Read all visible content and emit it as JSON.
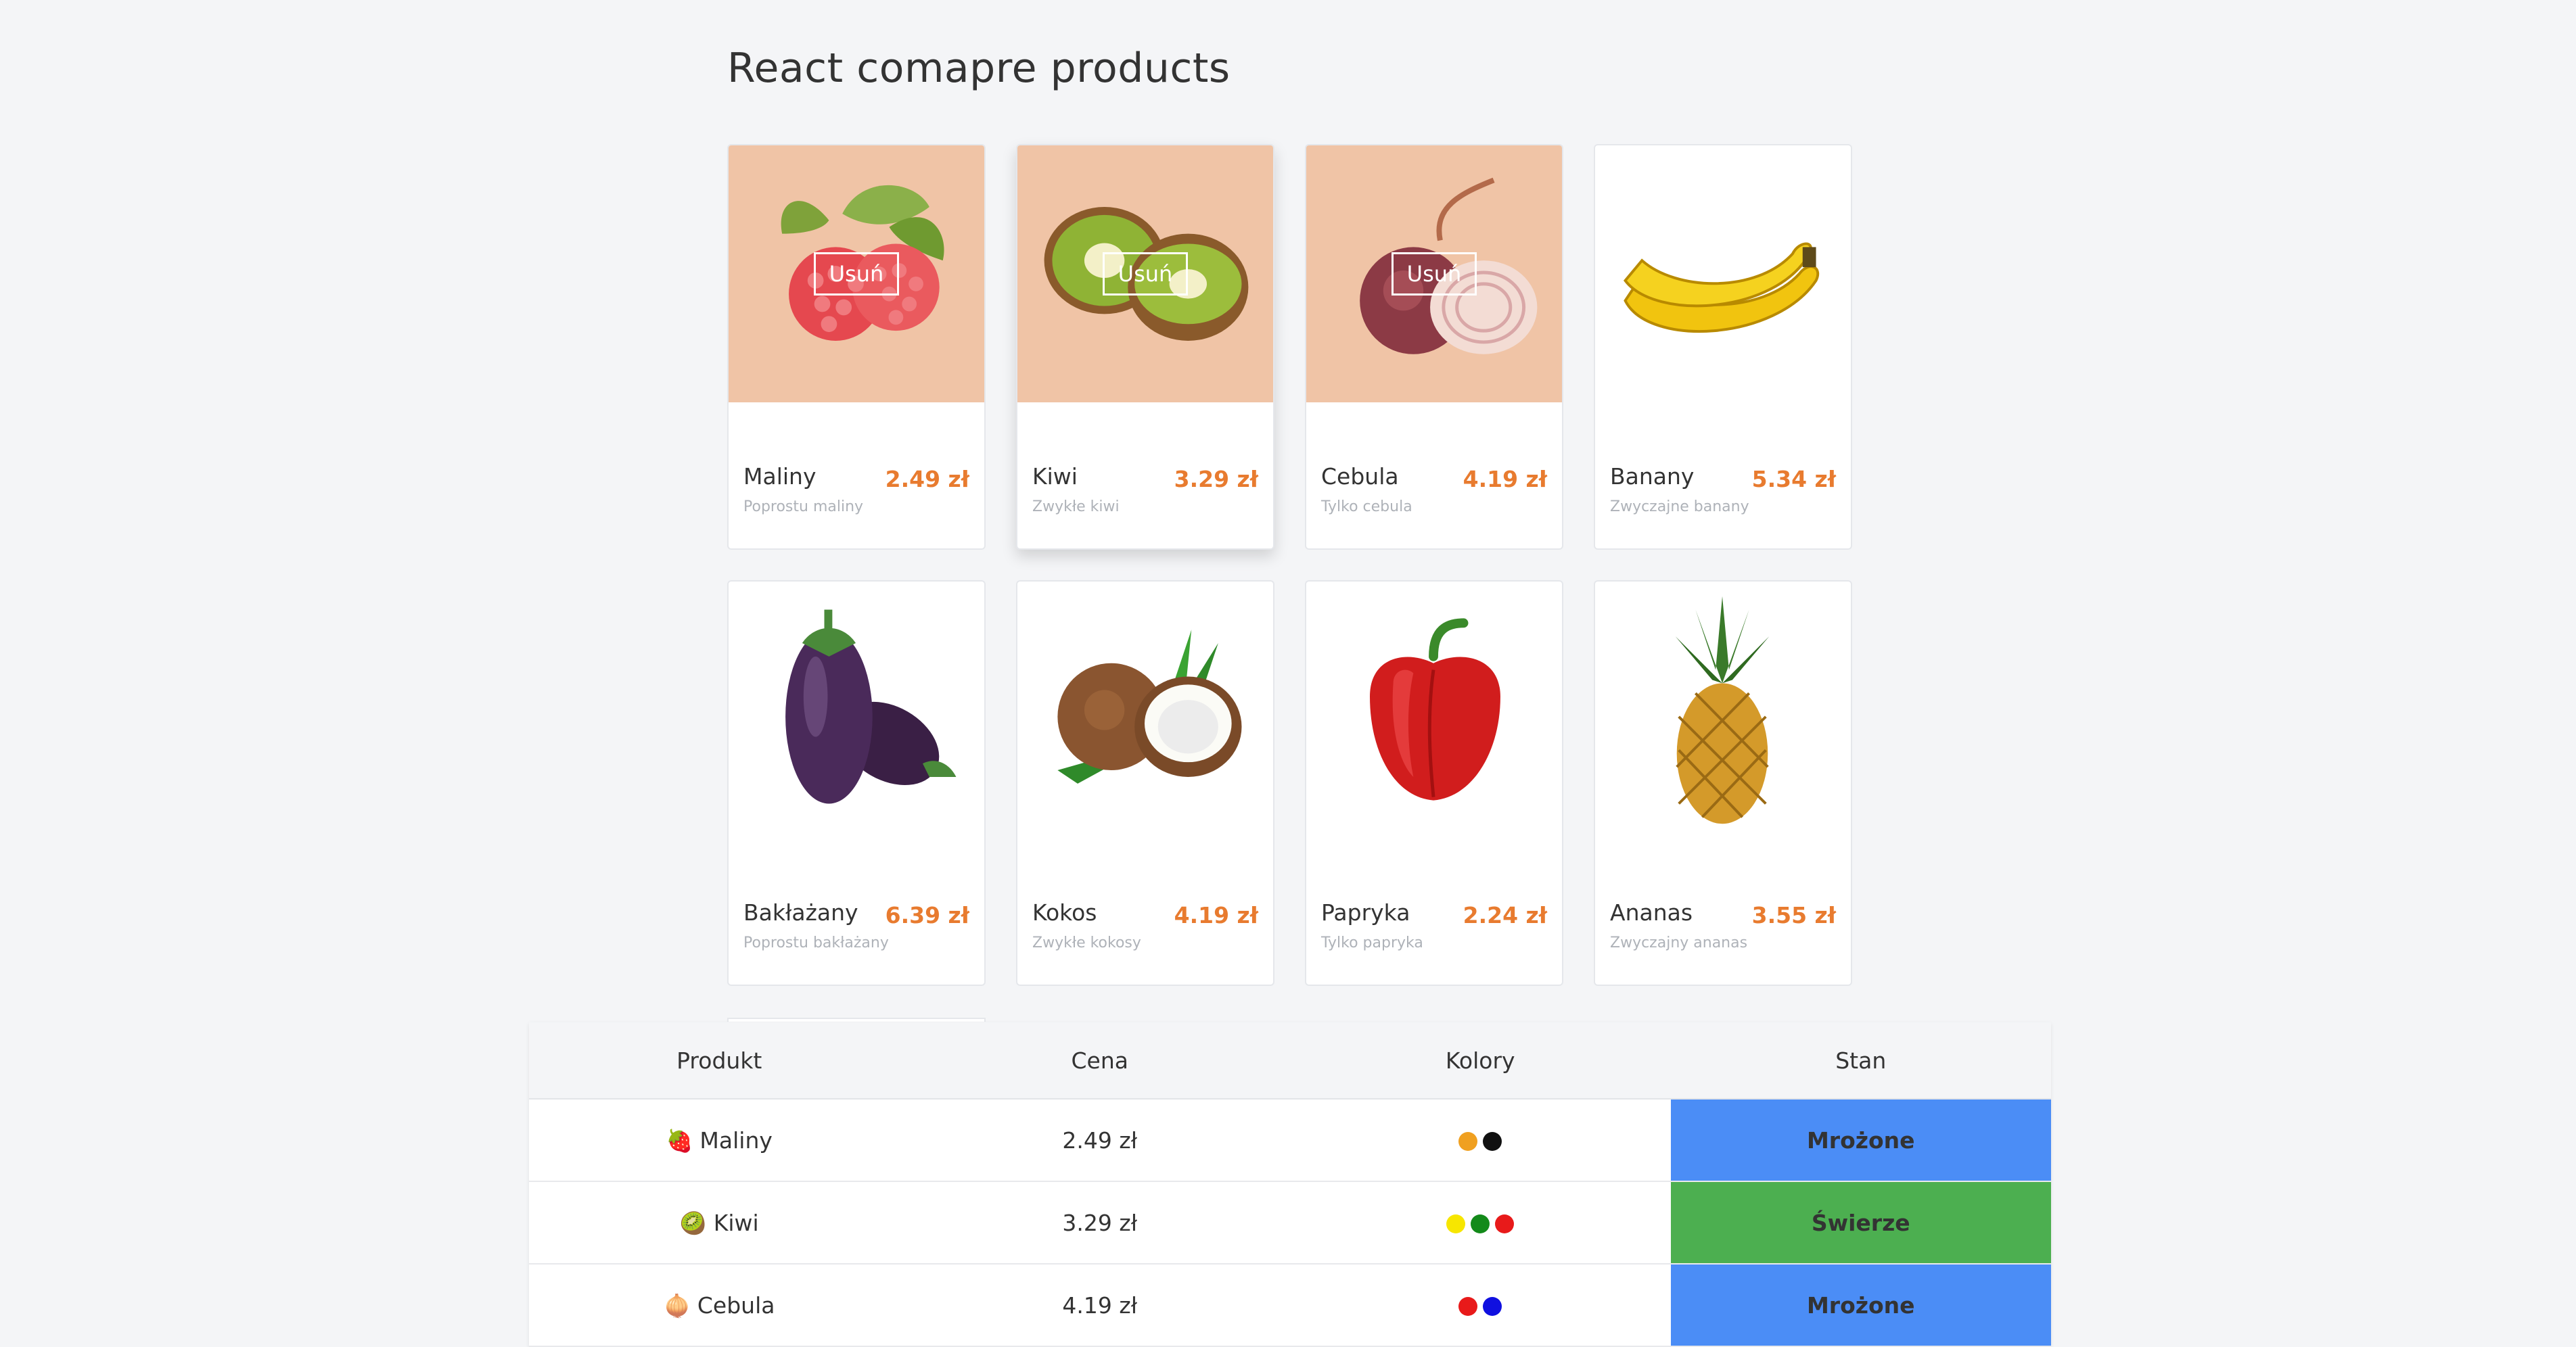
{
  "page": {
    "title": "React comapre products"
  },
  "products": [
    {
      "name": "Maliny",
      "price": "2.49 zł",
      "desc": "Poprostu maliny",
      "remove_label": "Usuń",
      "icon": "raspberry-icon"
    },
    {
      "name": "Kiwi",
      "price": "3.29 zł",
      "desc": "Zwykłe kiwi",
      "remove_label": "Usuń",
      "icon": "kiwi-icon"
    },
    {
      "name": "Cebula",
      "price": "4.19 zł",
      "desc": "Tylko cebula",
      "remove_label": "Usuń",
      "icon": "onion-icon"
    },
    {
      "name": "Banany",
      "price": "5.34 zł",
      "desc": "Zwyczajne banany",
      "icon": "banana-icon"
    },
    {
      "name": "Bakłażany",
      "price": "6.39 zł",
      "desc": "Poprostu bakłażany",
      "icon": "eggplant-icon"
    },
    {
      "name": "Kokos",
      "price": "4.19 zł",
      "desc": "Zwykłe kokosy",
      "icon": "coconut-icon"
    },
    {
      "name": "Papryka",
      "price": "2.24 zł",
      "desc": "Tylko papryka",
      "icon": "pepper-icon"
    },
    {
      "name": "Ananas",
      "price": "3.55 zł",
      "desc": "Zwyczajny ananas",
      "icon": "pineapple-icon"
    }
  ],
  "table": {
    "headers": [
      "Produkt",
      "Cena",
      "Kolory",
      "Stan"
    ],
    "rows": [
      {
        "emoji": "🍓",
        "product": "Maliny",
        "price": "2.49 zł",
        "colors": [
          "#f0a020",
          "#111111"
        ],
        "state": "Mrożone",
        "state_color": "#4b8df6"
      },
      {
        "emoji": "🥝",
        "product": "Kiwi",
        "price": "3.29 zł",
        "colors": [
          "#f7e600",
          "#138a1a",
          "#e81a1a"
        ],
        "state": "Świerze",
        "state_color": "#4caf50"
      },
      {
        "emoji": "🧅",
        "product": "Cebula",
        "price": "4.19 zł",
        "colors": [
          "#e81a1a",
          "#1010e0"
        ],
        "state": "Mrożone",
        "state_color": "#4b8df6"
      }
    ]
  },
  "colors": {
    "accent_price": "#e87b2f",
    "overlay_bg": "#f0c4a6"
  }
}
